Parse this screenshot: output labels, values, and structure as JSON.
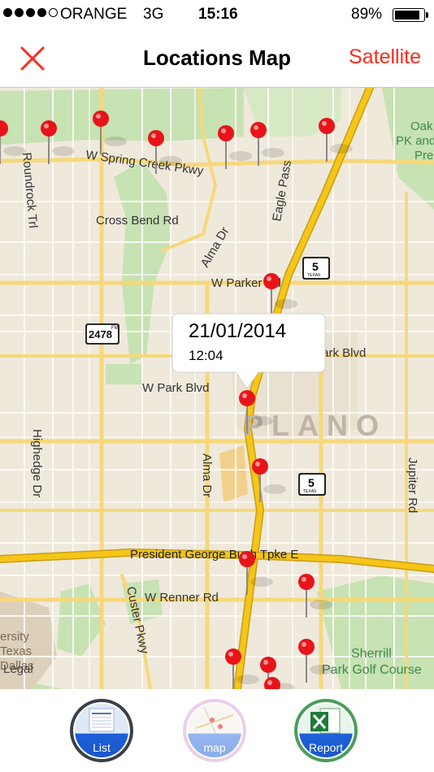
{
  "status_bar": {
    "carrier": "ORANGE",
    "network": "3G",
    "time": "15:16",
    "battery": "89%",
    "battery_level": 0.89,
    "signal_bars_filled": 4,
    "signal_bars_total": 5
  },
  "nav": {
    "title": "Locations Map",
    "close_icon": "close-x-icon",
    "right_button": "Satellite",
    "accent_color": "#ff2a1a"
  },
  "callout": {
    "date": "21/01/2014",
    "time": "12:04"
  },
  "map_labels": {
    "spring_creek": "W Spring Creek Pkwy",
    "roundrock": "Roundrock Trl",
    "cross_bend": "Cross Bend Rd",
    "eagle_pass": "Eagle Pass",
    "alma_dr_top": "Alma Dr",
    "alma_dr_bottom": "Alma Dr",
    "w_parker": "W Parker Rd",
    "e_park": "E Park Blvd",
    "w_park": "W Park Blvd",
    "plano": "PLANO",
    "highedge": "Highedge Dr",
    "jupiter": "Jupiter Rd",
    "pgbt": "President George Bush Tpke E",
    "renner": "W Renner Rd",
    "custer": "Custer Pkwy",
    "oak_line1": "Oak",
    "oak_line2": "PK and",
    "oak_line3": "Pre",
    "university_1": "ersity",
    "university_2": "Texas",
    "university_3": "Dallas",
    "legal": "Legal",
    "sherrill_1": "Sherrill",
    "sherrill_2": "Park Golf Course",
    "shield_fm": "2478",
    "shield_fm_small": "FM",
    "shield_us75_top": "5",
    "shield_us75_top_state": "TEXAS",
    "shield_us75_bottom": "5",
    "shield_us75_bottom_state": "TEXAS"
  },
  "pin_color": "#e8141a",
  "tabs": [
    {
      "label": "List",
      "icon": "list-doc-icon"
    },
    {
      "label": "map",
      "icon": "map-icon"
    },
    {
      "label": "Report",
      "icon": "excel-report-icon"
    }
  ]
}
